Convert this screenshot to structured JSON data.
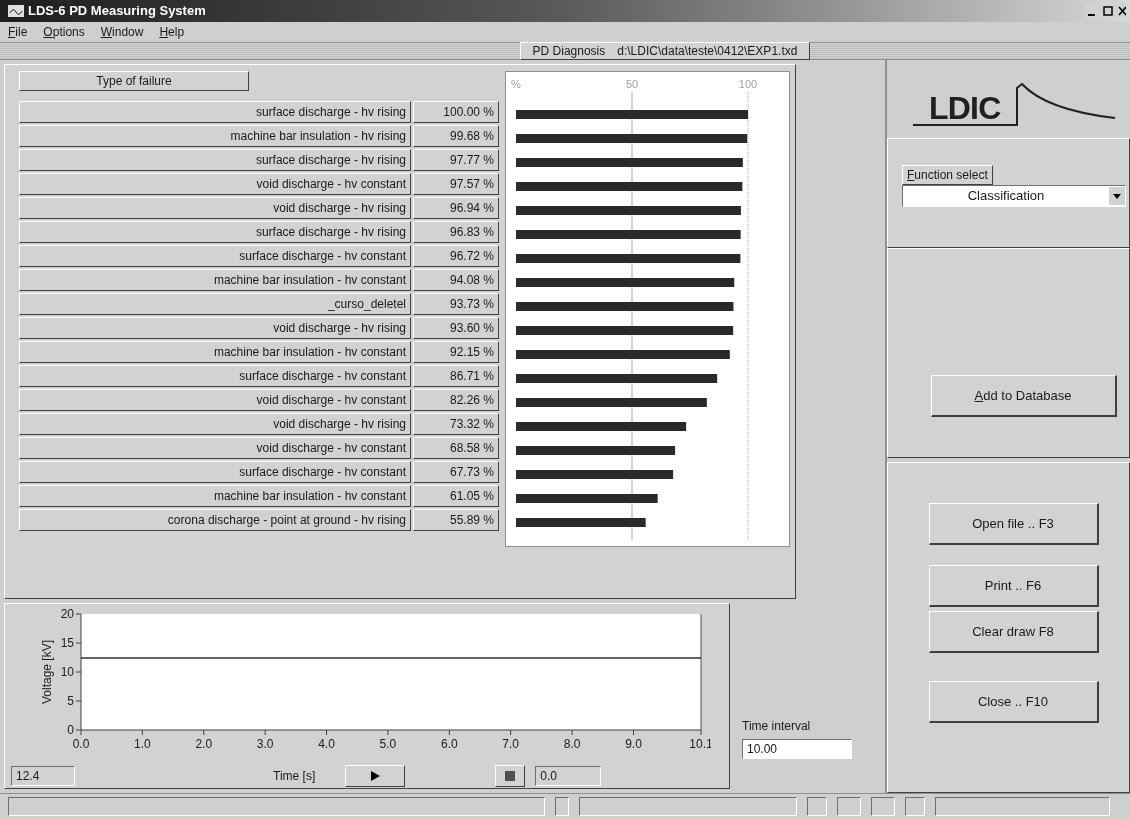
{
  "window": {
    "title": "LDS-6 PD Measuring System"
  },
  "menu": [
    "File",
    "Options",
    "Window",
    "Help"
  ],
  "diagnosis_bar": {
    "label": "PD Diagnosis",
    "path": "d:\\LDIC\\data\\teste\\0412\\EXP1.txd"
  },
  "classification": {
    "column_header": "Type of failure",
    "rows": [
      {
        "type": "surface discharge - hv rising",
        "percent": "100.00 %"
      },
      {
        "type": "machine bar insulation - hv rising",
        "percent": "99.68 %"
      },
      {
        "type": "surface discharge - hv rising",
        "percent": "97.77 %"
      },
      {
        "type": "void discharge - hv constant",
        "percent": "97.57 %"
      },
      {
        "type": "void discharge - hv rising",
        "percent": "96.94 %"
      },
      {
        "type": "surface discharge - hv rising",
        "percent": "96.83 %"
      },
      {
        "type": "surface discharge - hv constant",
        "percent": "96.72 %"
      },
      {
        "type": "machine bar insulation - hv constant",
        "percent": "94.08 %"
      },
      {
        "type": "_curso_deletel",
        "percent": "93.73 %"
      },
      {
        "type": "void discharge - hv rising",
        "percent": "93.60 %"
      },
      {
        "type": "machine bar insulation - hv constant",
        "percent": "92.15 %"
      },
      {
        "type": "surface discharge - hv constant",
        "percent": "86.71 %"
      },
      {
        "type": "void discharge - hv constant",
        "percent": "82.26 %"
      },
      {
        "type": "void discharge - hv rising",
        "percent": "73.32 %"
      },
      {
        "type": "void discharge - hv constant",
        "percent": "68.58 %"
      },
      {
        "type": "surface discharge - hv constant",
        "percent": "67.73 %"
      },
      {
        "type": "machine bar insulation - hv constant",
        "percent": "61.05 %"
      },
      {
        "type": "corona discharge - point at ground - hv rising",
        "percent": "55.89 %"
      }
    ],
    "chart_data": {
      "type": "bar",
      "orientation": "horizontal",
      "xlim": [
        0,
        100
      ],
      "xticks": [
        {
          "value": 0,
          "label": "%"
        },
        {
          "value": 50,
          "label": "50"
        },
        {
          "value": 100,
          "label": "100"
        }
      ],
      "values": [
        100.0,
        99.68,
        97.77,
        97.57,
        96.94,
        96.83,
        96.72,
        94.08,
        93.73,
        93.6,
        92.15,
        86.71,
        82.26,
        73.32,
        68.58,
        67.73,
        61.05,
        55.89
      ]
    }
  },
  "logo": "LDIC",
  "function_select": {
    "label": "Function select",
    "value": "Classification"
  },
  "add_button": "Add to Database",
  "action_buttons": [
    "Open file .. F3",
    "Print .. F6",
    "Clear draw  F8",
    "Close .. F10"
  ],
  "voltage_plot": {
    "reading": "12.4",
    "time_reading": "0.0",
    "time_interval_label": "Time interval",
    "time_interval": "10.00",
    "chart_data": {
      "type": "line",
      "xlabel": "Time [s]",
      "ylabel": "Voltage [kV]",
      "xlim": [
        0,
        10.1
      ],
      "ylim": [
        0,
        20
      ],
      "xticks": [
        {
          "value": 0,
          "label": "0.0"
        },
        {
          "value": 1,
          "label": "1.0"
        },
        {
          "value": 2,
          "label": "2.0"
        },
        {
          "value": 3,
          "label": "3.0"
        },
        {
          "value": 4,
          "label": "4.0"
        },
        {
          "value": 5,
          "label": "5.0"
        },
        {
          "value": 6,
          "label": "6.0"
        },
        {
          "value": 7,
          "label": "7.0"
        },
        {
          "value": 8,
          "label": "8.0"
        },
        {
          "value": 9,
          "label": "9.0"
        },
        {
          "value": 10.1,
          "label": "10.1"
        }
      ],
      "yticks": [
        0,
        5,
        10,
        15,
        20
      ],
      "x": [
        0,
        10.1
      ],
      "series": [
        {
          "color": "#303030",
          "values": [
            12.4,
            12.4
          ]
        }
      ]
    }
  }
}
